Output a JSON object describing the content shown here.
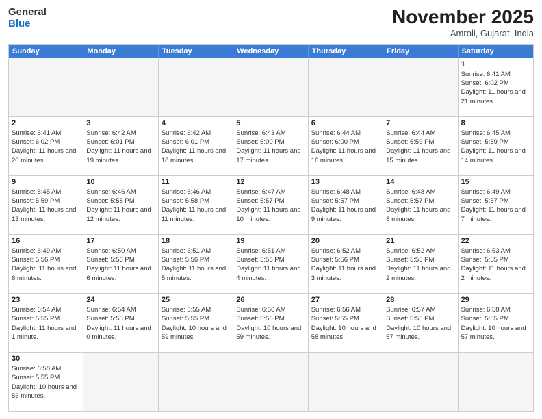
{
  "header": {
    "logo_general": "General",
    "logo_blue": "Blue",
    "month_year": "November 2025",
    "location": "Amroli, Gujarat, India"
  },
  "weekdays": [
    "Sunday",
    "Monday",
    "Tuesday",
    "Wednesday",
    "Thursday",
    "Friday",
    "Saturday"
  ],
  "days": [
    {
      "date": "",
      "empty": true
    },
    {
      "date": "",
      "empty": true
    },
    {
      "date": "",
      "empty": true
    },
    {
      "date": "",
      "empty": true
    },
    {
      "date": "",
      "empty": true
    },
    {
      "date": "",
      "empty": true
    },
    {
      "date": "1",
      "sunrise": "6:41 AM",
      "sunset": "6:02 PM",
      "daylight": "11 hours and 21 minutes."
    },
    {
      "date": "2",
      "sunrise": "6:41 AM",
      "sunset": "6:02 PM",
      "daylight": "11 hours and 20 minutes."
    },
    {
      "date": "3",
      "sunrise": "6:42 AM",
      "sunset": "6:01 PM",
      "daylight": "11 hours and 19 minutes."
    },
    {
      "date": "4",
      "sunrise": "6:42 AM",
      "sunset": "6:01 PM",
      "daylight": "11 hours and 18 minutes."
    },
    {
      "date": "5",
      "sunrise": "6:43 AM",
      "sunset": "6:00 PM",
      "daylight": "11 hours and 17 minutes."
    },
    {
      "date": "6",
      "sunrise": "6:44 AM",
      "sunset": "6:00 PM",
      "daylight": "11 hours and 16 minutes."
    },
    {
      "date": "7",
      "sunrise": "6:44 AM",
      "sunset": "5:59 PM",
      "daylight": "11 hours and 15 minutes."
    },
    {
      "date": "8",
      "sunrise": "6:45 AM",
      "sunset": "5:59 PM",
      "daylight": "11 hours and 14 minutes."
    },
    {
      "date": "9",
      "sunrise": "6:45 AM",
      "sunset": "5:59 PM",
      "daylight": "11 hours and 13 minutes."
    },
    {
      "date": "10",
      "sunrise": "6:46 AM",
      "sunset": "5:58 PM",
      "daylight": "11 hours and 12 minutes."
    },
    {
      "date": "11",
      "sunrise": "6:46 AM",
      "sunset": "5:58 PM",
      "daylight": "11 hours and 11 minutes."
    },
    {
      "date": "12",
      "sunrise": "6:47 AM",
      "sunset": "5:57 PM",
      "daylight": "11 hours and 10 minutes."
    },
    {
      "date": "13",
      "sunrise": "6:48 AM",
      "sunset": "5:57 PM",
      "daylight": "11 hours and 9 minutes."
    },
    {
      "date": "14",
      "sunrise": "6:48 AM",
      "sunset": "5:57 PM",
      "daylight": "11 hours and 8 minutes."
    },
    {
      "date": "15",
      "sunrise": "6:49 AM",
      "sunset": "5:57 PM",
      "daylight": "11 hours and 7 minutes."
    },
    {
      "date": "16",
      "sunrise": "6:49 AM",
      "sunset": "5:56 PM",
      "daylight": "11 hours and 6 minutes."
    },
    {
      "date": "17",
      "sunrise": "6:50 AM",
      "sunset": "5:56 PM",
      "daylight": "11 hours and 6 minutes."
    },
    {
      "date": "18",
      "sunrise": "6:51 AM",
      "sunset": "5:56 PM",
      "daylight": "11 hours and 5 minutes."
    },
    {
      "date": "19",
      "sunrise": "6:51 AM",
      "sunset": "5:56 PM",
      "daylight": "11 hours and 4 minutes."
    },
    {
      "date": "20",
      "sunrise": "6:52 AM",
      "sunset": "5:56 PM",
      "daylight": "11 hours and 3 minutes."
    },
    {
      "date": "21",
      "sunrise": "6:52 AM",
      "sunset": "5:55 PM",
      "daylight": "11 hours and 2 minutes."
    },
    {
      "date": "22",
      "sunrise": "6:53 AM",
      "sunset": "5:55 PM",
      "daylight": "11 hours and 2 minutes."
    },
    {
      "date": "23",
      "sunrise": "6:54 AM",
      "sunset": "5:55 PM",
      "daylight": "11 hours and 1 minute."
    },
    {
      "date": "24",
      "sunrise": "6:54 AM",
      "sunset": "5:55 PM",
      "daylight": "11 hours and 0 minutes."
    },
    {
      "date": "25",
      "sunrise": "6:55 AM",
      "sunset": "5:55 PM",
      "daylight": "10 hours and 59 minutes."
    },
    {
      "date": "26",
      "sunrise": "6:56 AM",
      "sunset": "5:55 PM",
      "daylight": "10 hours and 59 minutes."
    },
    {
      "date": "27",
      "sunrise": "6:56 AM",
      "sunset": "5:55 PM",
      "daylight": "10 hours and 58 minutes."
    },
    {
      "date": "28",
      "sunrise": "6:57 AM",
      "sunset": "5:55 PM",
      "daylight": "10 hours and 57 minutes."
    },
    {
      "date": "29",
      "sunrise": "6:58 AM",
      "sunset": "5:55 PM",
      "daylight": "10 hours and 57 minutes."
    },
    {
      "date": "30",
      "sunrise": "6:58 AM",
      "sunset": "5:55 PM",
      "daylight": "10 hours and 56 minutes."
    }
  ]
}
